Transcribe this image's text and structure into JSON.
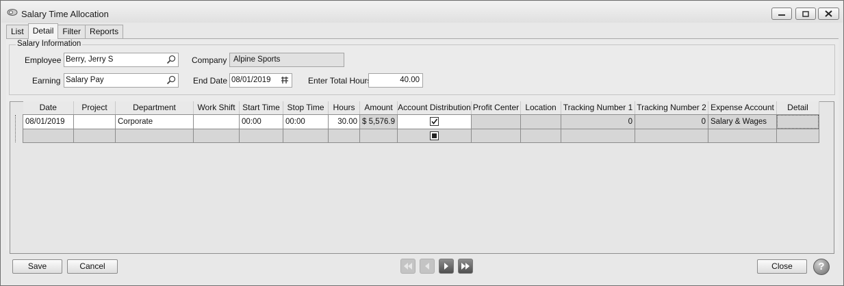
{
  "window": {
    "title": "Salary Time Allocation"
  },
  "tabs": [
    {
      "label": "List"
    },
    {
      "label": "Detail"
    },
    {
      "label": "Filter"
    },
    {
      "label": "Reports"
    }
  ],
  "salary_info": {
    "group_label": "Salary Information",
    "employee_label": "Employee",
    "employee_value": "Berry, Jerry S",
    "company_label": "Company",
    "company_value": "Alpine Sports",
    "earning_label": "Earning",
    "earning_value": "Salary Pay",
    "end_date_label": "End Date",
    "end_date_value": "08/01/2019",
    "total_hours_label": "Enter Total Hours",
    "total_hours_value": "40.00"
  },
  "grid": {
    "columns": [
      "Date",
      "Project",
      "Department",
      "Work Shift",
      "Start Time",
      "Stop Time",
      "Hours",
      "Amount",
      "Account Distribution",
      "Profit Center",
      "Location",
      "Tracking Number 1",
      "Tracking Number 2",
      "Expense Account",
      "Detail"
    ],
    "rows": [
      {
        "date": "08/01/2019",
        "project": "",
        "department": "Corporate",
        "work_shift": "",
        "start_time": "00:00",
        "stop_time": "00:00",
        "hours": "30.00",
        "amount": "$ 5,576.9",
        "account_distribution": true,
        "profit_center": "",
        "location": "",
        "tracking1": "0",
        "tracking2": "0",
        "expense_account": "Salary & Wages",
        "detail": ""
      }
    ]
  },
  "buttons": {
    "save": "Save",
    "cancel": "Cancel",
    "close": "Close",
    "help": "?"
  },
  "icons": {
    "lookup": "magnifier-icon",
    "calendar": "calendar-icon",
    "nav": [
      "first-record-icon",
      "previous-record-icon",
      "next-record-icon",
      "last-record-icon"
    ]
  }
}
